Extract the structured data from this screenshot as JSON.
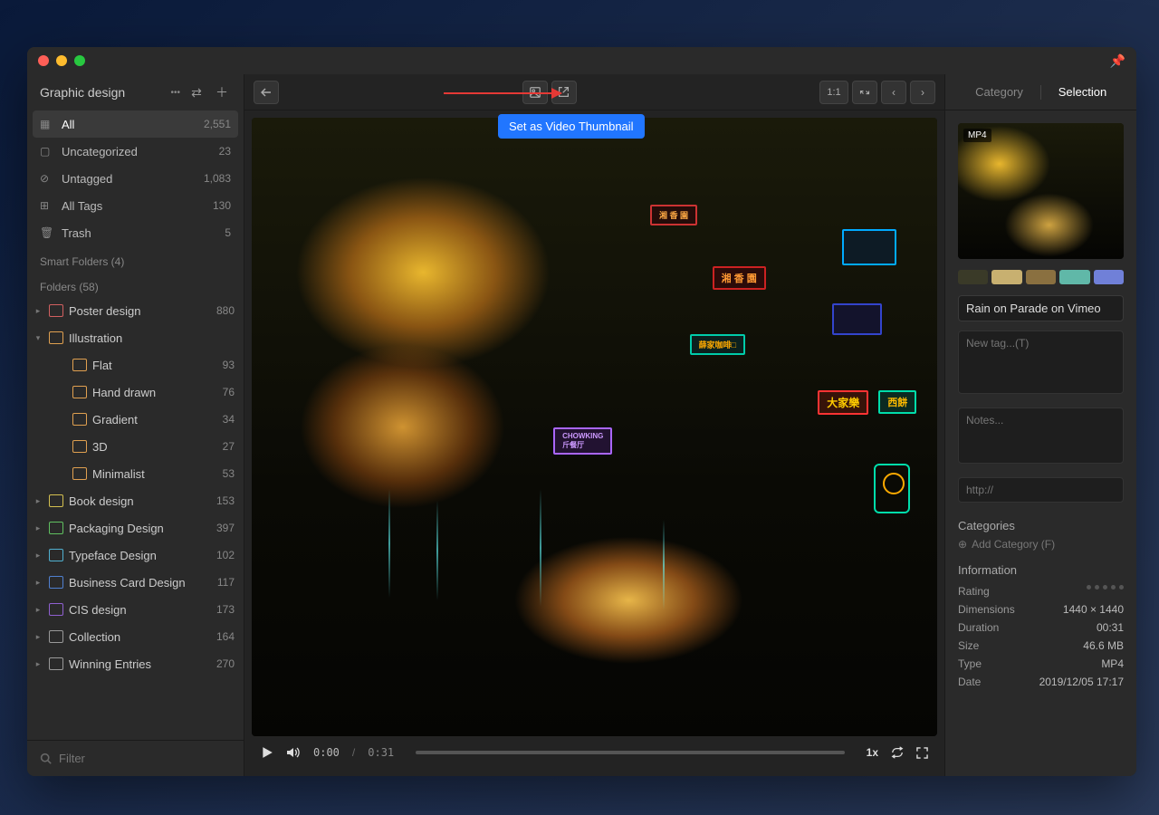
{
  "sidebar": {
    "library_title": "Graphic design",
    "items": [
      {
        "icon": "grid",
        "label": "All",
        "count": "2,551",
        "active": true
      },
      {
        "icon": "box",
        "label": "Uncategorized",
        "count": "23"
      },
      {
        "icon": "tag-x",
        "label": "Untagged",
        "count": "1,083"
      },
      {
        "icon": "bookmark",
        "label": "All Tags",
        "count": "130"
      },
      {
        "icon": "trash",
        "label": "Trash",
        "count": "5"
      }
    ],
    "smart_folders_label": "Smart Folders (4)",
    "folders_label": "Folders (58)",
    "folders": [
      {
        "label": "Poster design",
        "count": "880",
        "color": "#d16060",
        "expandable": true
      },
      {
        "label": "Illustration",
        "count": "",
        "color": "#e0a050",
        "expandable": true,
        "expanded": true,
        "children": [
          {
            "label": "Flat",
            "count": "93",
            "color": "#e0a050"
          },
          {
            "label": "Hand drawn",
            "count": "76",
            "color": "#e0a050"
          },
          {
            "label": "Gradient",
            "count": "34",
            "color": "#e0a050"
          },
          {
            "label": "3D",
            "count": "27",
            "color": "#e0a050"
          },
          {
            "label": "Minimalist",
            "count": "53",
            "color": "#e0a050"
          }
        ]
      },
      {
        "label": "Book design",
        "count": "153",
        "color": "#d4c050",
        "expandable": true
      },
      {
        "label": "Packaging Design",
        "count": "397",
        "color": "#60c060",
        "expandable": true
      },
      {
        "label": "Typeface Design",
        "count": "102",
        "color": "#50b0d0",
        "expandable": true
      },
      {
        "label": "Business Card Design",
        "count": "117",
        "color": "#5080d0",
        "expandable": true
      },
      {
        "label": "CIS design",
        "count": "173",
        "color": "#9060d0",
        "expandable": true
      },
      {
        "label": "Collection",
        "count": "164",
        "color": "#999",
        "expandable": true
      },
      {
        "label": "Winning Entries",
        "count": "270",
        "color": "#999",
        "expandable": true
      }
    ],
    "filter_placeholder": "Filter"
  },
  "toolbar": {
    "tooltip": "Set as Video Thumbnail",
    "ratio_label": "1:1"
  },
  "video": {
    "current_time": "0:00",
    "duration": "0:31",
    "speed": "1x"
  },
  "inspector": {
    "tab_category": "Category",
    "tab_selection": "Selection",
    "thumb_badge": "MP4",
    "swatches": [
      "#3a3a28",
      "#c8b070",
      "#8a7040",
      "#60b8a8",
      "#7080d8"
    ],
    "name": "Rain on Parade on Vimeo",
    "tag_placeholder": "New tag...(T)",
    "notes_placeholder": "Notes...",
    "url_placeholder": "http://",
    "categories_label": "Categories",
    "add_category": "Add Category (F)",
    "info_label": "Information",
    "info": [
      {
        "k": "Rating",
        "v": ""
      },
      {
        "k": "Dimensions",
        "v": "1440 × 1440"
      },
      {
        "k": "Duration",
        "v": "00:31"
      },
      {
        "k": "Size",
        "v": "46.6 MB"
      },
      {
        "k": "Type",
        "v": "MP4"
      },
      {
        "k": "Date",
        "v": "2019/12/05 17:17"
      }
    ]
  }
}
